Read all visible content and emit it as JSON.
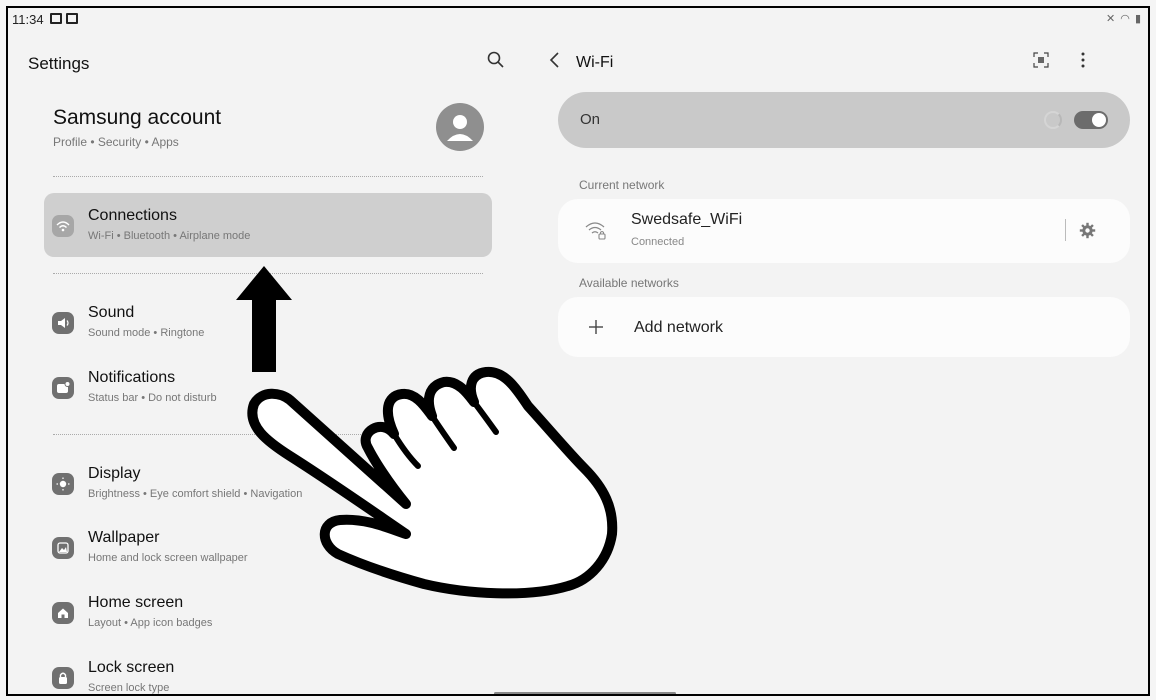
{
  "status_bar": {
    "time": "11:34"
  },
  "settings": {
    "title": "Settings",
    "account": {
      "title": "Samsung account",
      "subtitle": "Profile  •  Security  •  Apps"
    },
    "items": [
      {
        "title": "Connections",
        "subtitle": "Wi-Fi  •  Bluetooth  •  Airplane mode",
        "icon": "wifi-icon"
      },
      {
        "title": "Sound",
        "subtitle": "Sound mode  •  Ringtone",
        "icon": "speaker-icon"
      },
      {
        "title": "Notifications",
        "subtitle": "Status bar  •  Do not disturb",
        "icon": "notification-icon"
      },
      {
        "title": "Display",
        "subtitle": "Brightness  •  Eye comfort shield  •  Navigation",
        "icon": "brightness-icon"
      },
      {
        "title": "Wallpaper",
        "subtitle": "Home and lock screen wallpaper",
        "icon": "wallpaper-icon"
      },
      {
        "title": "Home screen",
        "subtitle": "Layout  •  App icon badges",
        "icon": "home-icon"
      },
      {
        "title": "Lock screen",
        "subtitle": "Screen lock type",
        "icon": "lock-icon"
      }
    ]
  },
  "wifi": {
    "title": "Wi-Fi",
    "toggle_label": "On",
    "toggle_on": true,
    "current_network_label": "Current network",
    "current_network": {
      "name": "Swedsafe_WiFi",
      "status": "Connected"
    },
    "available_networks_label": "Available networks",
    "add_network_label": "Add network"
  },
  "colors": {
    "background": "#f3f3f3",
    "active_item": "#cfcfcf",
    "toggle_card": "#c9c9c9",
    "card": "#fcfcfc"
  }
}
